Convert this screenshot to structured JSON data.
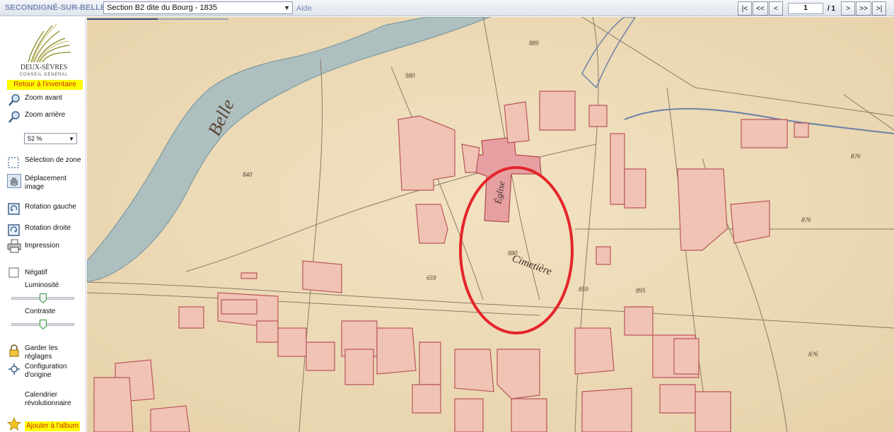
{
  "header": {
    "commune": "SECONDIGNÉ-SUR-BELLE",
    "section_selected": "Section B2 dite du Bourg - 1835",
    "help_link": "Aide",
    "pager": {
      "first": "|<",
      "prev_fast": "<<",
      "prev": "<",
      "current_page": "1",
      "total": "/ 1",
      "next": ">",
      "next_fast": ">>",
      "last": ">|"
    }
  },
  "sidebar": {
    "logo_text": "DEUX-SÈVRES",
    "logo_subtext": "CONSEIL GÉNÉRAL",
    "back_to_inventory": "Retour à l'inventaire",
    "zoom_in": "Zoom avant",
    "zoom_out": "Zoom arrière",
    "zoom_level": "52 %",
    "zone_selection": "Sélection de zone",
    "pan_image": "Déplacement image",
    "rotate_left": "Rotation gauche",
    "rotate_right": "Rotation droite",
    "print": "Impression",
    "negative": "Négatif",
    "brightness": "Luminosité",
    "contrast": "Contraste",
    "keep_settings": "Garder les réglages",
    "reset_config": "Configuration d'origine",
    "revolutionary_calendar": "Calendrier révolutionnaire",
    "add_to_album": "Ajouter à l'album"
  },
  "sliders": {
    "brightness": 0.5,
    "contrast": 0.5
  },
  "colors": {
    "accent_text": "#7a8cb4",
    "highlight_bg": "#ffff00",
    "highlight_text": "#cc2a00",
    "parchment": "#ecd9b4",
    "parcel_pink": "#f0c3b5",
    "river": "#aebfc0",
    "annotation_red": "#e5252b"
  },
  "map": {
    "labels": {
      "church": "Église",
      "cemetery": "Cimetière",
      "stream": "Belle"
    }
  }
}
